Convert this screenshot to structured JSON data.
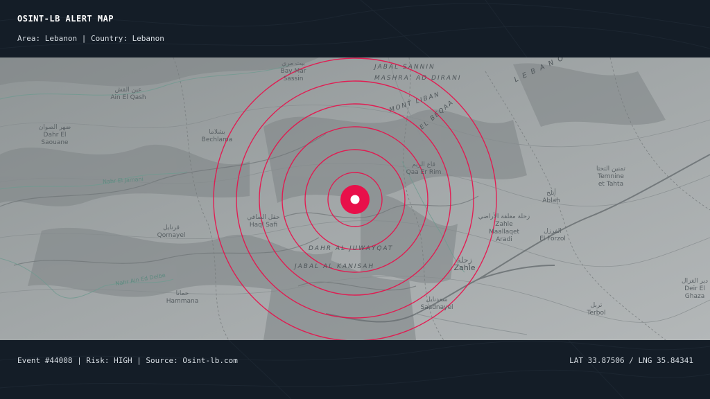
{
  "header": {
    "title": "OSINT-LB ALERT MAP",
    "area_line": "Area: Lebanon | Country: Lebanon"
  },
  "footer": {
    "event_line": "Event #44008 | Risk: HIGH | Source: Osint-lb.com",
    "lat_label": "LAT",
    "lat_value": "33.87506",
    "lng_label": "LNG",
    "lng_value": "35.84341"
  },
  "map": {
    "alert_color": "#e8104a",
    "ring_count": 6,
    "places": [
      {
        "key": "bay_mar_sassin",
        "en": "Bay Mar\nSassin",
        "ar": "بيت مري"
      },
      {
        "key": "ain_el_qash",
        "en": "Ain El Qash",
        "ar": "عين القش"
      },
      {
        "key": "dahr_el_saouane",
        "en": "Dahr El\nSaouane",
        "ar": "ضهر الصوان"
      },
      {
        "key": "bechlama",
        "en": "Bechlama",
        "ar": "بشلاما"
      },
      {
        "key": "haql_safi",
        "en": "Haql Safi",
        "ar": "حقل الصافي"
      },
      {
        "key": "qornayel",
        "en": "Qornayel",
        "ar": "قرنايل"
      },
      {
        "key": "hammana",
        "en": "Hammana",
        "ar": "حمانا"
      },
      {
        "key": "qaa_er_rim",
        "en": "Qaa Er Rim",
        "ar": "قاع الريم"
      },
      {
        "key": "temnine",
        "en": "Temnine\net Tahta",
        "ar": "تمنين التحتا"
      },
      {
        "key": "ablah",
        "en": "Ablah",
        "ar": "أبلح"
      },
      {
        "key": "zahle_maallaqet",
        "en": "Zahle\nMaallaqet\nAradi",
        "ar": "زحلة معلقة الأراضي"
      },
      {
        "key": "el_forzol",
        "en": "El Forzol",
        "ar": "الفرزل"
      },
      {
        "key": "zahle",
        "en": "Zahle",
        "ar": "زحلة"
      },
      {
        "key": "saadnayel",
        "en": "Saadnayel",
        "ar": "سعدنايل"
      },
      {
        "key": "terbol",
        "en": "Terbol",
        "ar": "تربل"
      },
      {
        "key": "deir_el_ghazal",
        "en": "Deir El\nGhaza",
        "ar": "دير الغزال"
      }
    ],
    "regions": [
      {
        "key": "jabal_sannin",
        "text": "JABAL SANNIN"
      },
      {
        "key": "mashra",
        "text": "MASHRA' AD DIRANI"
      },
      {
        "key": "mont_liban",
        "text": "MONT LIBAN"
      },
      {
        "key": "el_beqaa",
        "text": "EL BEQAA"
      },
      {
        "key": "dahr",
        "text": "DAHR AL JUWAYQAT"
      },
      {
        "key": "jabal_kanisah",
        "text": "JABAL AL KANISAH"
      },
      {
        "key": "lebanon",
        "text": "L E B A N O N"
      }
    ],
    "rivers": [
      {
        "key": "nahr_el_jamani",
        "text": "Nahr El Jamani"
      },
      {
        "key": "nahr_ain_ed_delbe",
        "text": "Nahr Ain Ed Delbe"
      }
    ]
  }
}
